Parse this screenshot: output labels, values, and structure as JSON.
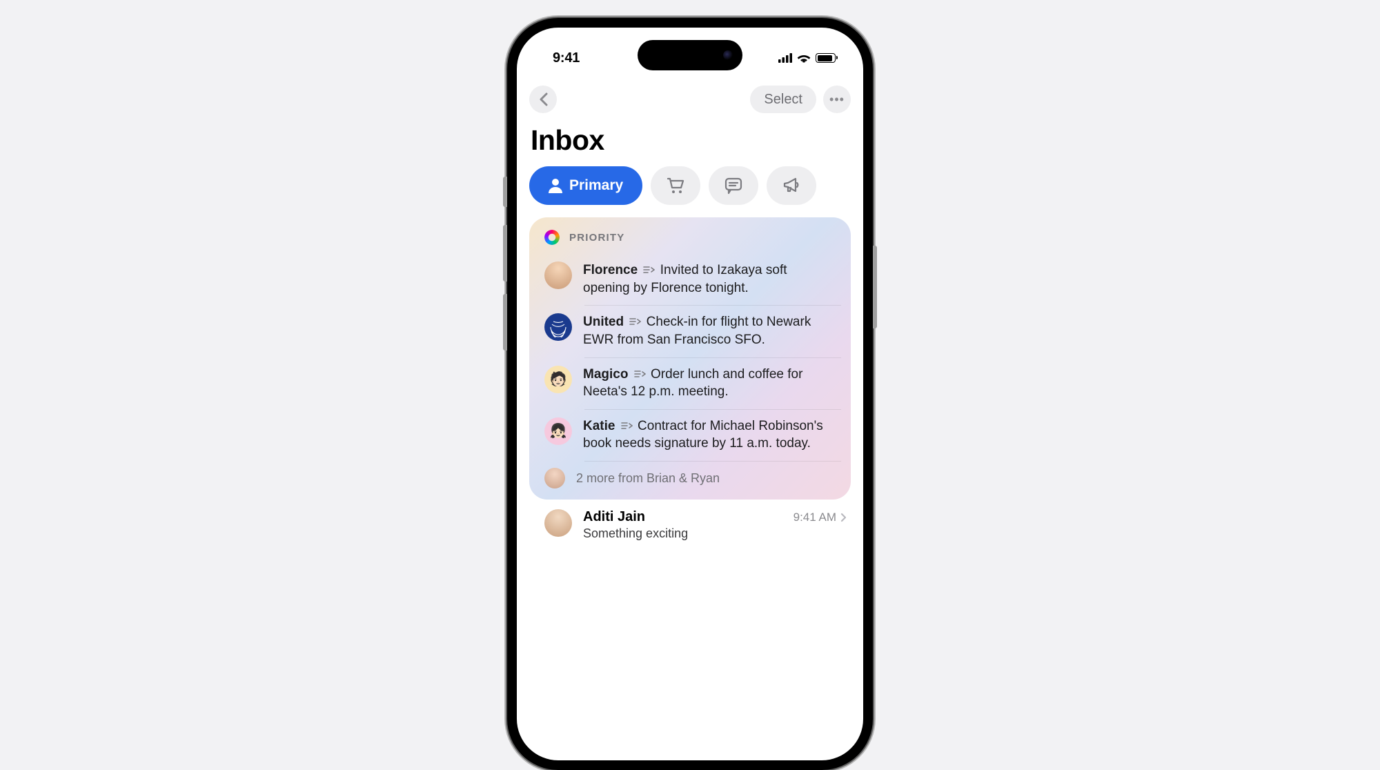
{
  "statusbar": {
    "time": "9:41"
  },
  "nav": {
    "select_label": "Select"
  },
  "page": {
    "title": "Inbox"
  },
  "tabs": {
    "primary_label": "Primary",
    "secondary_icons": [
      "cart-icon",
      "chat-icon",
      "megaphone-icon"
    ]
  },
  "priority": {
    "header_label": "PRIORITY",
    "items": [
      {
        "sender": "Florence",
        "summary": "Invited to Izakaya soft opening by Florence tonight.",
        "avatar": "av-1"
      },
      {
        "sender": "United",
        "summary": "Check-in for flight to Newark EWR from San Francisco SFO.",
        "avatar": "av-2"
      },
      {
        "sender": "Magico",
        "summary": "Order lunch and coffee for Neeta's 12 p.m. meeting.",
        "avatar": "av-3"
      },
      {
        "sender": "Katie",
        "summary": "Contract for Michael Robinson's book needs signature by 11 a.m. today.",
        "avatar": "av-4"
      }
    ],
    "more_label": "2 more from Brian & Ryan",
    "more_avatar": "av-5"
  },
  "inbox": {
    "items": [
      {
        "sender": "Aditi Jain",
        "subject": "Something exciting",
        "time": "9:41 AM",
        "avatar": "av-6"
      }
    ]
  }
}
